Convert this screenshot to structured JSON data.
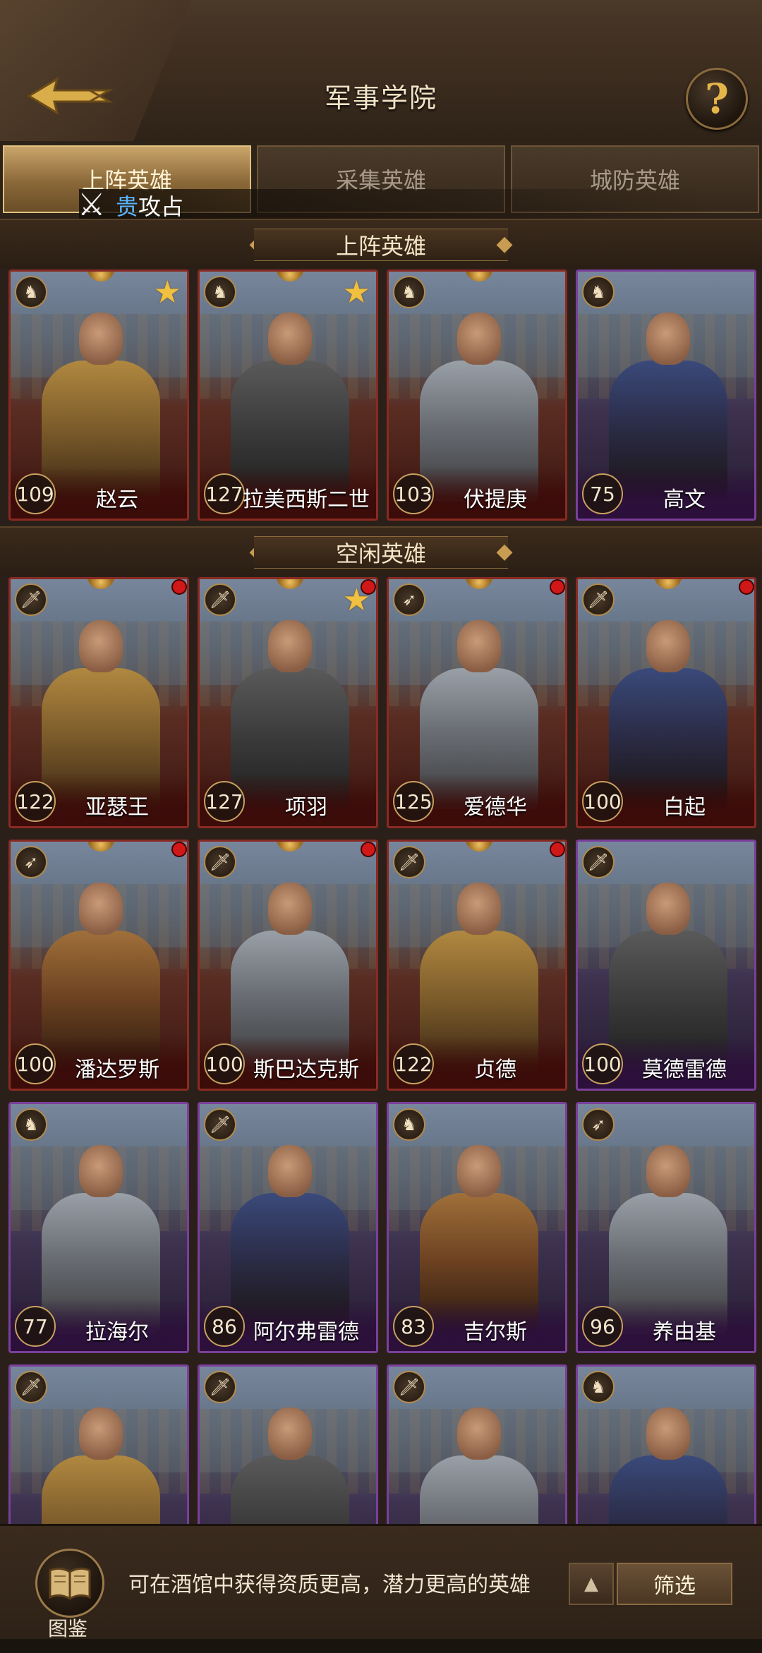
{
  "header": {
    "title": "军事学院",
    "help_symbol": "?"
  },
  "tabs": [
    {
      "label": "上阵英雄",
      "active": true
    },
    {
      "label": "采集英雄",
      "active": false
    },
    {
      "label": "城防英雄",
      "active": false
    }
  ],
  "marquee": {
    "highlight": "贵",
    "text": "攻占"
  },
  "sections": {
    "deployed": "上阵英雄",
    "idle": "空闲英雄"
  },
  "deployed_heroes": [
    {
      "name": "赵云",
      "level": "109",
      "type": "cavalry",
      "star": true,
      "frame": "red"
    },
    {
      "name": "拉美西斯二世",
      "level": "127",
      "type": "cavalry",
      "star": true,
      "frame": "red"
    },
    {
      "name": "伏提庚",
      "level": "103",
      "type": "cavalry",
      "star": false,
      "frame": "red"
    },
    {
      "name": "高文",
      "level": "75",
      "type": "cavalry",
      "star": false,
      "frame": "purple"
    }
  ],
  "idle_heroes": [
    {
      "name": "亚瑟王",
      "level": "122",
      "type": "infantry",
      "star": false,
      "dot": true,
      "frame": "red"
    },
    {
      "name": "项羽",
      "level": "127",
      "type": "infantry",
      "star": true,
      "dot": true,
      "frame": "red"
    },
    {
      "name": "爱德华",
      "level": "125",
      "type": "archer",
      "star": false,
      "dot": true,
      "frame": "red"
    },
    {
      "name": "白起",
      "level": "100",
      "type": "infantry",
      "star": false,
      "dot": true,
      "frame": "red"
    },
    {
      "name": "潘达罗斯",
      "level": "100",
      "type": "archer",
      "star": false,
      "dot": true,
      "frame": "red"
    },
    {
      "name": "斯巴达克斯",
      "level": "100",
      "type": "infantry",
      "star": false,
      "dot": true,
      "frame": "red"
    },
    {
      "name": "贞德",
      "level": "122",
      "type": "infantry",
      "star": false,
      "dot": true,
      "frame": "red"
    },
    {
      "name": "莫德雷德",
      "level": "100",
      "type": "infantry",
      "star": false,
      "dot": false,
      "frame": "purple"
    },
    {
      "name": "拉海尔",
      "level": "77",
      "type": "cavalry",
      "star": false,
      "dot": false,
      "frame": "purple"
    },
    {
      "name": "阿尔弗雷德",
      "level": "86",
      "type": "infantry",
      "star": false,
      "dot": false,
      "frame": "purple"
    },
    {
      "name": "吉尔斯",
      "level": "83",
      "type": "cavalry",
      "star": false,
      "dot": false,
      "frame": "purple"
    },
    {
      "name": "养由基",
      "level": "96",
      "type": "archer",
      "star": false,
      "dot": false,
      "frame": "purple"
    },
    {
      "name": "",
      "level": "",
      "type": "infantry",
      "star": false,
      "dot": false,
      "frame": "purple"
    },
    {
      "name": "",
      "level": "",
      "type": "infantry",
      "star": false,
      "dot": false,
      "frame": "purple"
    },
    {
      "name": "",
      "level": "",
      "type": "infantry",
      "star": false,
      "dot": false,
      "frame": "purple"
    },
    {
      "name": "",
      "level": "",
      "type": "cavalry",
      "star": false,
      "dot": false,
      "frame": "purple"
    }
  ],
  "type_icons": {
    "cavalry": "horse-icon",
    "infantry": "sword-icon",
    "archer": "bow-icon"
  },
  "footer": {
    "book_label": "图鉴",
    "hint": "可在酒馆中获得资质更高，潜力更高的英雄",
    "sort_symbol": "▲",
    "filter_label": "筛选"
  },
  "colors": {
    "red_frame": "#8a2a22",
    "purple_frame": "#7a3f9a",
    "gold": "#c8a060",
    "star": "#f0c040"
  }
}
